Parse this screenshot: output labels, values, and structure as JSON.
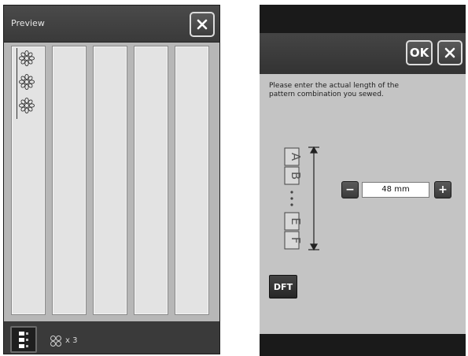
{
  "left_panel": {
    "title": "Preview",
    "repeat_text": "x 3",
    "icons": {
      "close": "close-icon",
      "layout": "stitch-layout-icon",
      "repeat": "pattern-repeat-icon",
      "flower": "flower-stitch-icon"
    }
  },
  "right_panel": {
    "ok_label": "OK",
    "instruction": "Please enter the actual length of the pattern combination you sewed.",
    "length_value": "48 mm",
    "minus_label": "−",
    "plus_label": "+",
    "dft_label": "DFT",
    "illustration_letters": [
      "A",
      "B",
      "E",
      "F"
    ],
    "icons": {
      "close": "close-icon",
      "pattern_length": "pattern-length-icon"
    }
  },
  "colors": {
    "panel_dark": "#2b2b2b",
    "preview_bg": "#b7b7b7",
    "dialog_bg": "#c4c4c4",
    "button_border": "#dcdcdc"
  }
}
